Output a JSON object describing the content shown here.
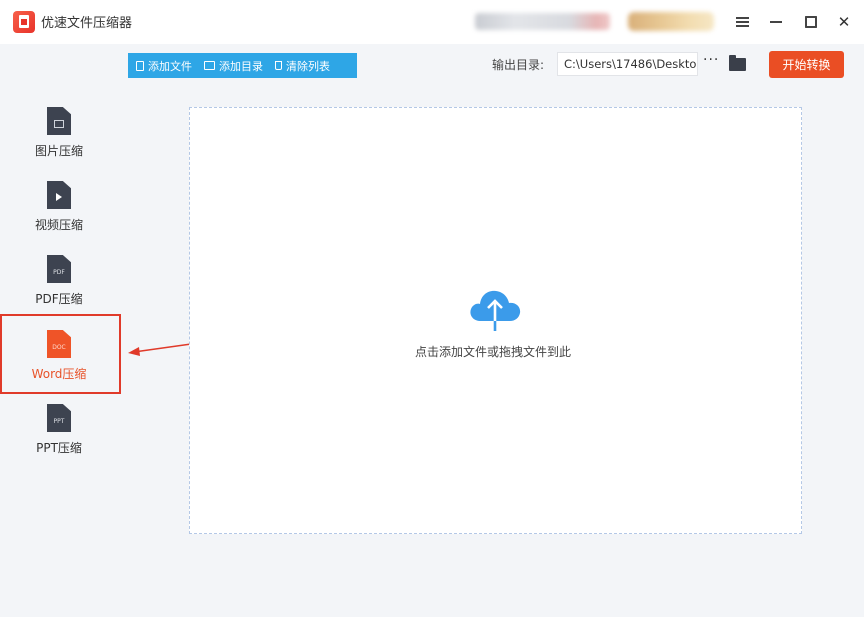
{
  "window": {
    "title": "优速文件压缩器"
  },
  "toolbar": {
    "add_file": "添加文件",
    "add_folder": "添加目录",
    "clear_list": "清除列表"
  },
  "output": {
    "label": "输出目录:",
    "path": "C:\\Users\\17486\\Deskto",
    "more": "···"
  },
  "start_button": "开始转换",
  "sidebar": {
    "items": [
      {
        "label": "图片压缩",
        "icon": "image-file-icon"
      },
      {
        "label": "视频压缩",
        "icon": "video-file-icon"
      },
      {
        "label": "PDF压缩",
        "icon": "pdf-file-icon",
        "tag": "PDF"
      },
      {
        "label": "Word压缩",
        "icon": "doc-file-icon",
        "tag": "DOC",
        "active": true
      },
      {
        "label": "PPT压缩",
        "icon": "ppt-file-icon",
        "tag": "PPT"
      }
    ]
  },
  "dropzone": {
    "hint": "点击添加文件或拖拽文件到此"
  },
  "colors": {
    "accent_blue": "#2ea6e6",
    "start_orange": "#ea4e24",
    "highlight_red": "#e03a2a",
    "cloud_blue": "#3b9bea"
  }
}
